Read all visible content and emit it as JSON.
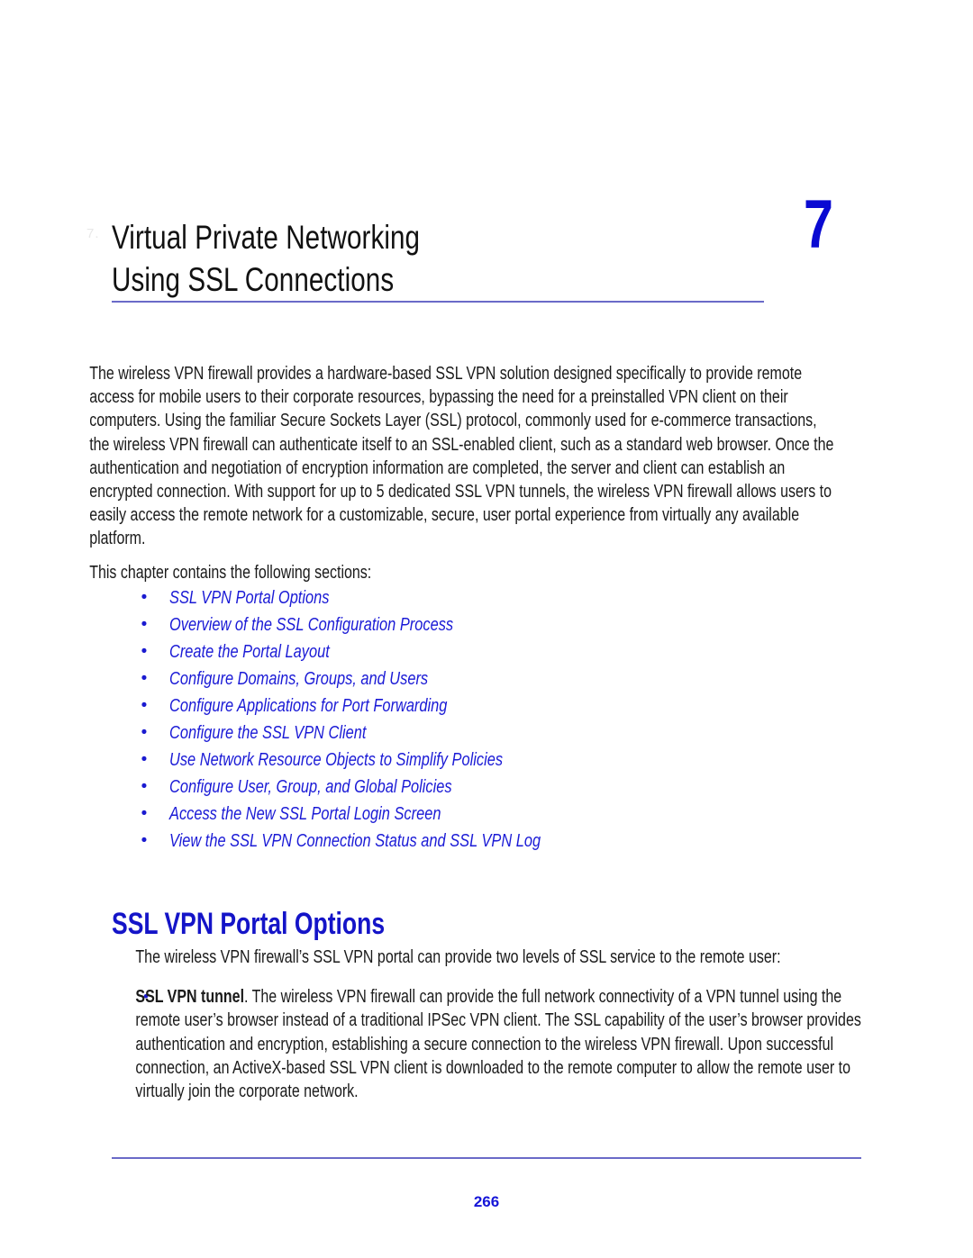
{
  "page": {
    "number": "266",
    "colors": {
      "link_blue": "#1a1ad6",
      "heading_blue": "#1414c8",
      "rule_blue": "#6a6ac8",
      "chapter_number_blue": "#0a0ad2",
      "body_black": "#1a1a1a"
    }
  },
  "chapter": {
    "title_line_1": "Virtual Private Networking",
    "title_line_2": "Using SSL Connections",
    "number": "7",
    "margin_artifact": "7."
  },
  "intro": {
    "paragraph": "The wireless VPN firewall provides a hardware-based SSL VPN solution designed specifically to provide remote access for mobile users to their corporate resources, bypassing the need for a preinstalled VPN client on their computers. Using the familiar Secure Sockets Layer (SSL) protocol, commonly used for e-commerce transactions, the wireless VPN firewall can authenticate itself to an SSL-enabled client, such as a standard web browser. Once the authentication and negotiation of encryption information are completed, the server and client can establish an encrypted connection. With support for up to 5 dedicated SSL VPN tunnels, the wireless VPN firewall allows users to easily access the remote network for a customizable, secure, user portal experience from virtually any available platform.",
    "sections_lead": "This chapter contains the following sections:"
  },
  "toc": {
    "bullet_glyph": "•",
    "items": [
      {
        "label": "SSL VPN Portal Options"
      },
      {
        "label": "Overview of the SSL Configuration Process"
      },
      {
        "label": "Create the Portal Layout"
      },
      {
        "label": "Configure Domains, Groups, and Users"
      },
      {
        "label": "Configure Applications for Port Forwarding"
      },
      {
        "label": "Configure the SSL VPN Client"
      },
      {
        "label": "Use Network Resource Objects to Simplify Policies"
      },
      {
        "label": "Configure User, Group, and Global Policies"
      },
      {
        "label": "Access the New SSL Portal Login Screen"
      },
      {
        "label": "View the SSL VPN Connection Status and SSL VPN Log"
      }
    ]
  },
  "section": {
    "heading": "SSL VPN Portal Options",
    "intro": "The wireless VPN firewall’s SSL VPN portal can provide two levels of SSL service to the remote user:",
    "bullet_glyph": "•",
    "item_term": "SSL VPN tunnel",
    "item_body": ". The wireless VPN firewall can provide the full network connectivity of a VPN tunnel using the remote user’s browser instead of a traditional IPSec VPN client. The SSL capability of the user’s browser provides authentication and encryption, establishing a secure connection to the wireless VPN firewall. Upon successful connection, an ActiveX-based SSL VPN client is downloaded to the remote computer to allow the remote user to virtually join the corporate network."
  }
}
